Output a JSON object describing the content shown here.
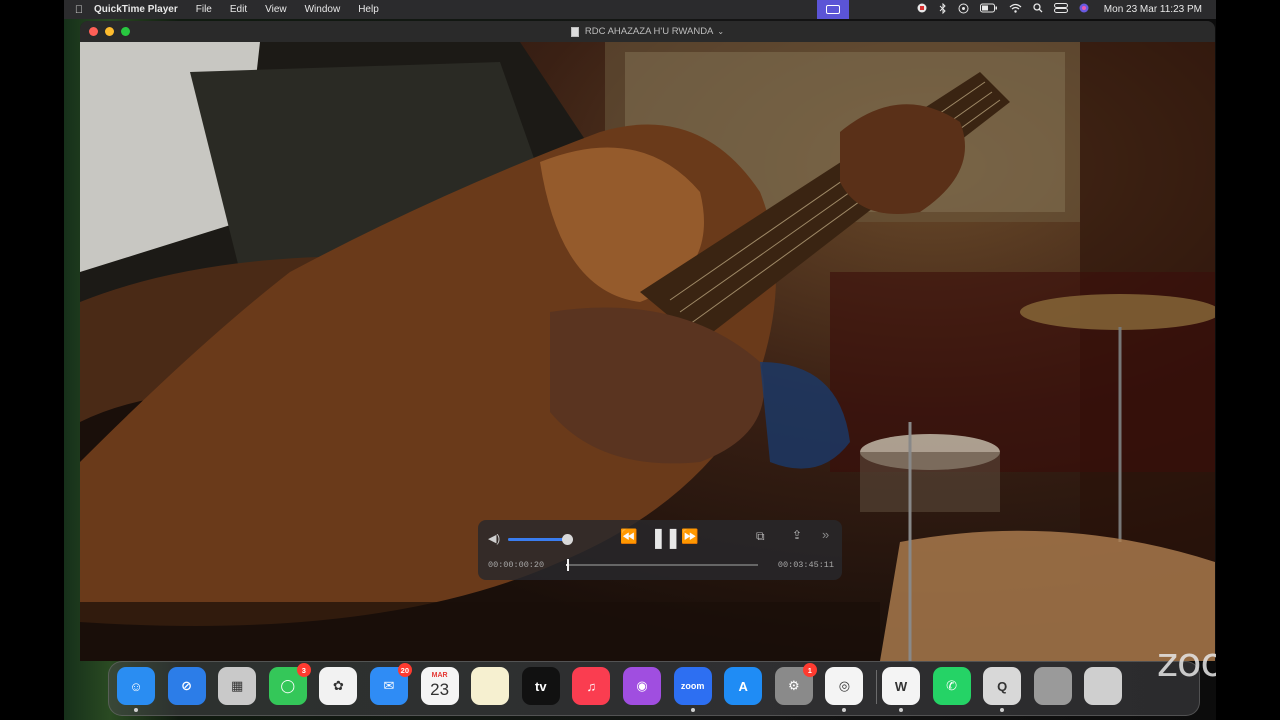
{
  "menubar": {
    "apple_icon": "apple-icon",
    "menus": [
      "QuickTime Player",
      "File",
      "Edit",
      "View",
      "Window",
      "Help"
    ],
    "clock": "Mon 23 Mar  11:23 PM"
  },
  "window": {
    "title": "RDC AHAZAZA H'U RWANDA",
    "title_chevron": "⌄"
  },
  "player": {
    "current_time": "00:00:00:20",
    "duration": "00:03:45:11",
    "volume_fraction": 0.95,
    "progress_fraction": 0.004,
    "rewind_icon": "⏪",
    "pause_icon": "❚❚",
    "forward_icon": "⏩",
    "pip_icon": "⧉",
    "share_icon": "⇪",
    "more_icon": "»",
    "volume_icon": "◀)"
  },
  "dock": {
    "apps": [
      {
        "name": "Finder",
        "glyph": "☺",
        "color": "#2a8df2",
        "badge": "",
        "running": true
      },
      {
        "name": "Safari",
        "glyph": "⊘",
        "color": "#2c7de8",
        "badge": "",
        "running": false
      },
      {
        "name": "Launchpad",
        "glyph": "▦",
        "color": "#c9c9c9",
        "badge": "",
        "running": false
      },
      {
        "name": "Messages",
        "glyph": "◯",
        "color": "#34c759",
        "badge": "3",
        "running": false
      },
      {
        "name": "Photos",
        "glyph": "✿",
        "color": "#f2f2f2",
        "badge": "",
        "running": false
      },
      {
        "name": "Mail",
        "glyph": "✉",
        "color": "#2f8cf5",
        "badge": "20",
        "running": false
      },
      {
        "name": "Calendar",
        "glyph": "23",
        "color": "#f5f5f5",
        "badge": "",
        "running": false,
        "month": "MAR"
      },
      {
        "name": "Notes",
        "glyph": "",
        "color": "#f6f0d0",
        "badge": "",
        "running": false
      },
      {
        "name": "TV",
        "glyph": "tv",
        "color": "#111111",
        "badge": "",
        "running": false
      },
      {
        "name": "Music",
        "glyph": "♫",
        "color": "#fa3d50",
        "badge": "",
        "running": false
      },
      {
        "name": "Podcasts",
        "glyph": "◉",
        "color": "#a04ee0",
        "badge": "",
        "running": false
      },
      {
        "name": "Zoom",
        "glyph": "zoom",
        "color": "#2d6ff2",
        "badge": "",
        "running": true
      },
      {
        "name": "App Store",
        "glyph": "A",
        "color": "#1f8cf5",
        "badge": "",
        "running": false
      },
      {
        "name": "System Preferences",
        "glyph": "⚙",
        "color": "#8a8a8a",
        "badge": "1",
        "running": false
      },
      {
        "name": "Chrome",
        "glyph": "◎",
        "color": "#f4f4f4",
        "badge": "",
        "running": true
      },
      {
        "name": "Word",
        "glyph": "W",
        "color": "#f4f4f4",
        "badge": "",
        "running": true
      },
      {
        "name": "WhatsApp",
        "glyph": "✆",
        "color": "#25d366",
        "badge": "",
        "running": false
      },
      {
        "name": "QuickTime Player",
        "glyph": "Q",
        "color": "#d8d8d8",
        "badge": "",
        "running": true
      },
      {
        "name": "Downloads",
        "glyph": "",
        "color": "#9a9a9a",
        "badge": "",
        "running": false
      },
      {
        "name": "Trash",
        "glyph": "",
        "color": "#cfcfcf",
        "badge": "",
        "running": false
      }
    ]
  },
  "watermark": "zoom"
}
